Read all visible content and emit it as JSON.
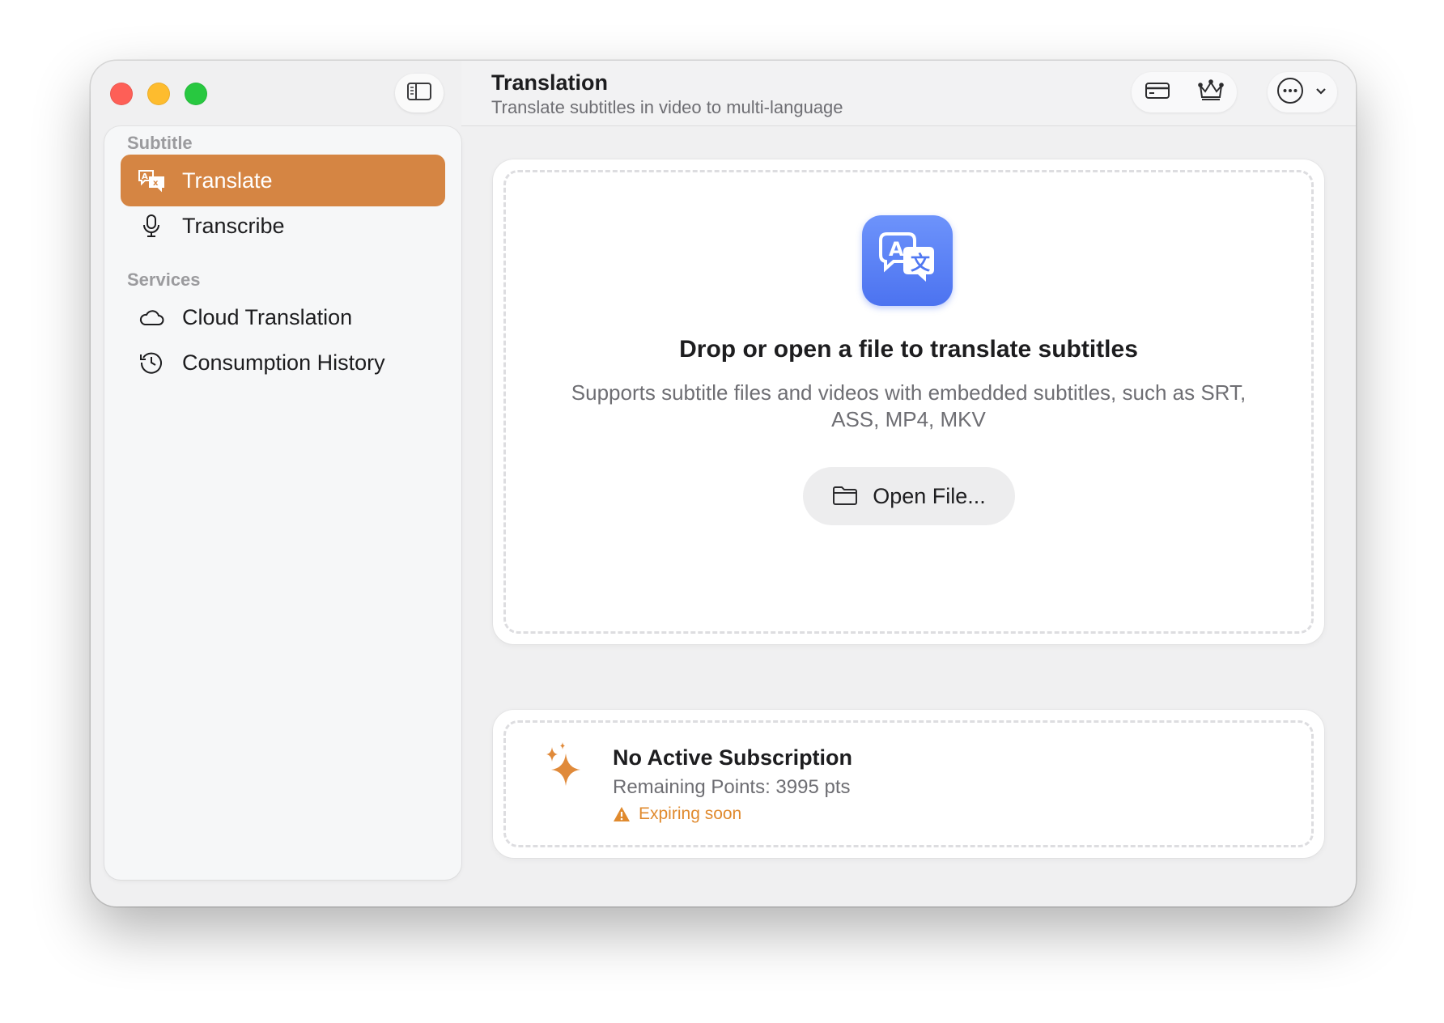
{
  "window": {
    "traffic_lights": [
      "close",
      "minimize",
      "zoom"
    ]
  },
  "header": {
    "title": "Translation",
    "subtitle": "Translate subtitles in video to multi-language",
    "icons": [
      "card-icon",
      "crown-icon",
      "more-icon",
      "chevron-down-icon"
    ]
  },
  "sidebar": {
    "sections": [
      {
        "label": "Subtitle",
        "items": [
          {
            "label": "Translate",
            "icon": "translate-icon",
            "active": true
          },
          {
            "label": "Transcribe",
            "icon": "microphone-icon",
            "active": false
          }
        ]
      },
      {
        "label": "Services",
        "items": [
          {
            "label": "Cloud Translation",
            "icon": "cloud-icon",
            "active": false
          },
          {
            "label": "Consumption History",
            "icon": "history-icon",
            "active": false
          }
        ]
      }
    ]
  },
  "dropzone": {
    "title": "Drop or open a file to translate subtitles",
    "description": "Supports subtitle files and videos with embedded subtitles, such as SRT, ASS, MP4, MKV",
    "open_button": "Open File..."
  },
  "subscription": {
    "title": "No Active Subscription",
    "points": "Remaining Points: 3995 pts",
    "warning": "Expiring soon"
  },
  "colors": {
    "accent": "#d58543",
    "warning": "#e08a2e",
    "app_icon": "#5b80f5"
  }
}
